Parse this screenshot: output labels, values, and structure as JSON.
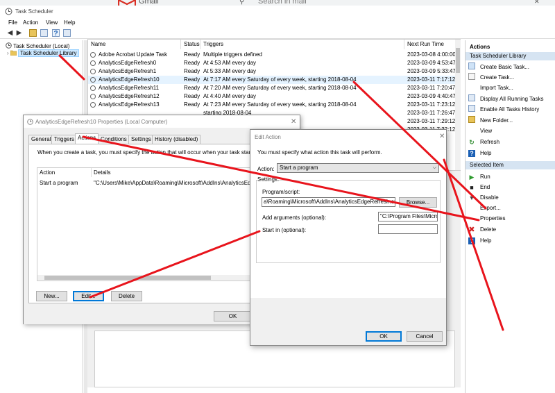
{
  "gmail_tab": {
    "logo_text": "Gmail",
    "search_placeholder": "Search in mail"
  },
  "window": {
    "title": "Task Scheduler",
    "menu": [
      "File",
      "Action",
      "View",
      "Help"
    ]
  },
  "tree": {
    "root": "Task Scheduler (Local)",
    "library": "Task Scheduler Library"
  },
  "task_list": {
    "columns": [
      "Name",
      "Status",
      "Triggers",
      "Next Run Time"
    ],
    "rows": [
      {
        "name": "Adobe Acrobat Update Task",
        "status": "Ready",
        "triggers": "Multiple triggers defined",
        "next": "2023-03-08 4:00:00 PI"
      },
      {
        "name": "AnalyticsEdgeRefresh0",
        "status": "Ready",
        "triggers": "At 4:53 AM every day",
        "next": "2023-03-09 4:53:47 A"
      },
      {
        "name": "AnalyticsEdgeRefresh1",
        "status": "Ready",
        "triggers": "At 5:33 AM every day",
        "next": "2023-03-09 5:33:47 A"
      },
      {
        "name": "AnalyticsEdgeRefresh10",
        "status": "Ready",
        "triggers": "At 7:17 AM every Saturday of every week, starting 2018-08-04",
        "next": "2023-03-11 7:17:12 A"
      },
      {
        "name": "AnalyticsEdgeRefresh11",
        "status": "Ready",
        "triggers": "At 7:20 AM every Saturday of every week, starting 2018-08-04",
        "next": "2023-03-11 7:20:47 A"
      },
      {
        "name": "AnalyticsEdgeRefresh12",
        "status": "Ready",
        "triggers": "At 4:40 AM every day",
        "next": "2023-03-09 4:40:47 A"
      },
      {
        "name": "AnalyticsEdgeRefresh13",
        "status": "Ready",
        "triggers": "At 7:23 AM every Saturday of every week, starting 2018-08-04",
        "next": "2023-03-11 7:23:12 A"
      },
      {
        "name": "",
        "status": "",
        "triggers": "starting 2018-08-04",
        "next": "2023-03-11 7:26:47 A"
      },
      {
        "name": "",
        "status": "",
        "triggers": "starting 2018-08-04",
        "next": "2023-03-11 7:29:12 A"
      },
      {
        "name": "",
        "status": "",
        "triggers": "starting 2018-08-04",
        "next": "2023-03-11 7:32:12 A"
      }
    ]
  },
  "actions_pane": {
    "header": "Actions",
    "section1": "Task Scheduler Library",
    "section1_items": [
      "Create Basic Task...",
      "Create Task...",
      "Import Task...",
      "Display All Running Tasks",
      "Enable All Tasks History",
      "New Folder...",
      "View",
      "Refresh",
      "Help"
    ],
    "section2": "Selected Item",
    "section2_items": [
      "Run",
      "End",
      "Disable",
      "Export...",
      "Properties",
      "Delete",
      "Help"
    ]
  },
  "props_dialog": {
    "title": "AnalyticsEdgeRefresh10 Properties (Local Computer)",
    "tabs": [
      "General",
      "Triggers",
      "Actions",
      "Conditions",
      "Settings",
      "History (disabled)"
    ],
    "description": "When you create a task, you must specify the action that will occur when your task starts.",
    "grid_headers": [
      "Action",
      "Details"
    ],
    "grid_row": {
      "action": "Start a program",
      "details": "\"C:\\Users\\Mike\\AppData\\Roaming\\Microsoft\\AddIns\\AnalyticsEdge"
    },
    "buttons": {
      "new": "New...",
      "edit": "Edit...",
      "delete": "Delete",
      "ok": "OK"
    }
  },
  "edit_dialog": {
    "title": "Edit Action",
    "description": "You must specify what action this task will perform.",
    "action_label": "Action:",
    "action_value": "Start a program",
    "settings_label": "Settings:",
    "program_label": "Program/script:",
    "program_value": "a\\Roaming\\Microsoft\\AddIns\\AnalyticsEdgeRefresh.exe",
    "browse": "Browse...",
    "args_label": "Add arguments (optional):",
    "args_value": "\"C:\\Program Files\\Micro",
    "startin_label": "Start in (optional):",
    "startin_value": "",
    "ok": "OK",
    "cancel": "Cancel"
  },
  "colors": {
    "annotation_red": "#e8141c",
    "selection_blue": "#cce8ff",
    "section_header": "#d6e4f2"
  }
}
